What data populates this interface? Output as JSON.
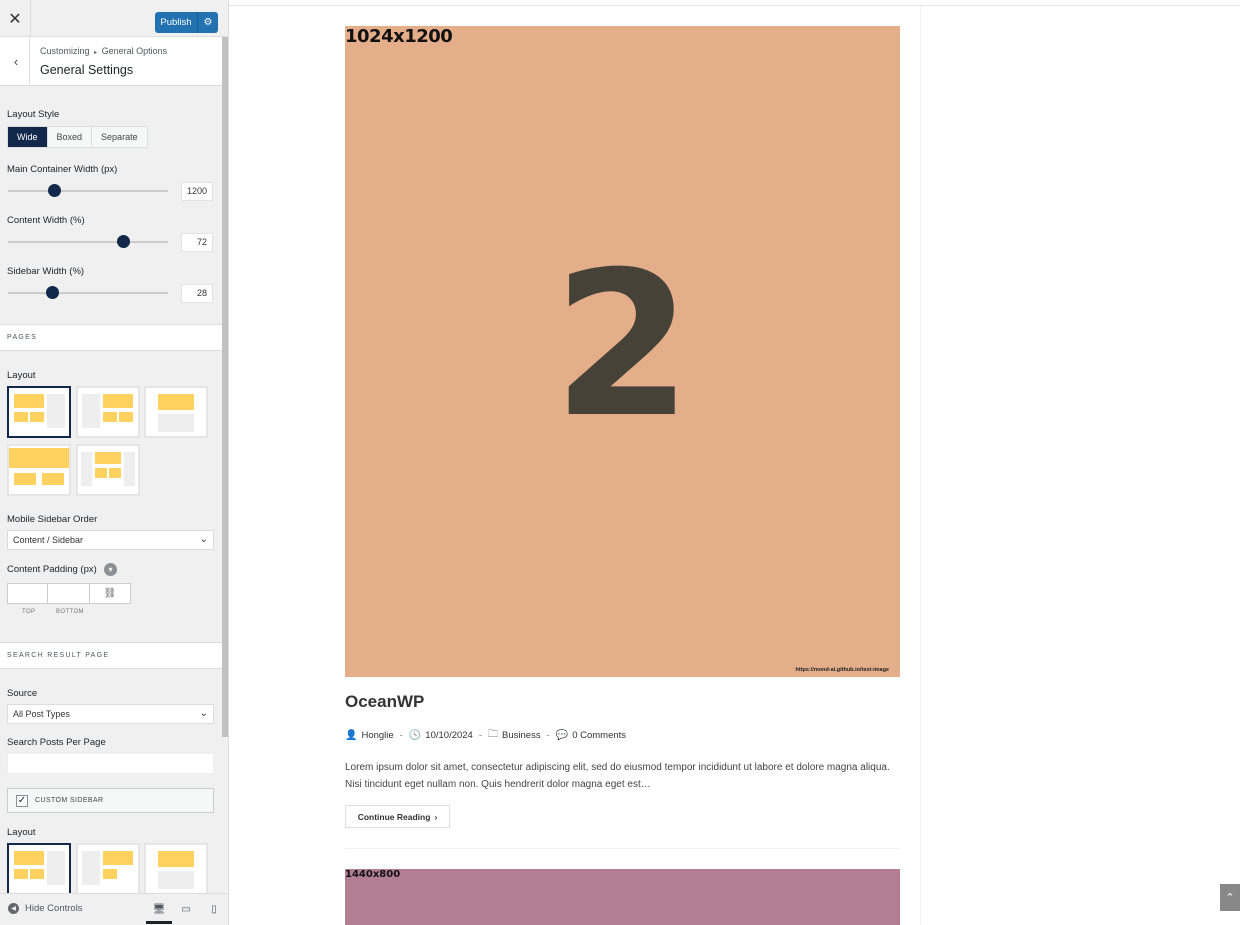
{
  "topbar": {
    "close_label": "✕",
    "publish_label": "Publish",
    "publish_gear_icon": "gear-icon"
  },
  "section": {
    "breadcrumb_parent": "Customizing",
    "breadcrumb_separator": "▸",
    "breadcrumb_current": "General Options",
    "title": "General Settings"
  },
  "layout_style": {
    "label": "Layout Style",
    "options": [
      "Wide",
      "Boxed",
      "Separate"
    ],
    "selected": "Wide"
  },
  "sliders": [
    {
      "label": "Main Container Width (px)",
      "value": "1200",
      "fraction": 0.29
    },
    {
      "label": "Content Width (%)",
      "value": "72",
      "fraction": 0.72
    },
    {
      "label": "Sidebar Width (%)",
      "value": "28",
      "fraction": 0.28
    }
  ],
  "pages": {
    "band_title": "PAGES",
    "layout_label": "Layout",
    "mobile_order_label": "Mobile Sidebar Order",
    "mobile_order_value": "Content / Sidebar",
    "padding_label": "Content Padding (px)",
    "padding_top_caption": "TOP",
    "padding_bottom_caption": "BOTTOM"
  },
  "search_page": {
    "band_title": "SEARCH RESULT PAGE",
    "source_label": "Source",
    "source_value": "All Post Types",
    "per_page_label": "Search Posts Per Page",
    "per_page_value": "",
    "custom_sidebar_label": "CUSTOM SIDEBAR",
    "custom_sidebar_checked": true,
    "layout_label": "Layout"
  },
  "footer": {
    "hide_controls_label": "Hide Controls"
  },
  "preview": {
    "image_label": "1024x1200",
    "image_number": "2",
    "image_url": "https://mond-al.github.io/test-image",
    "image_color": "#e3ae89",
    "post_title": "OceanWP",
    "author": "Honglie",
    "date": "10/10/2024",
    "category": "Business",
    "comments": "0 Comments",
    "excerpt": "Lorem ipsum dolor sit amet, consectetur adipiscing elit, sed do eiusmod tempor incididunt ut labore et dolore magna aliqua. Nisi tincidunt eget nullam non. Quis hendrerit dolor magna eget est…",
    "continue_label": "Continue Reading",
    "next_image_label": "1440x800",
    "next_image_color": "#b47e92"
  },
  "colors": {
    "accent_dark": "#13294b",
    "publish_blue": "#2271b1"
  }
}
